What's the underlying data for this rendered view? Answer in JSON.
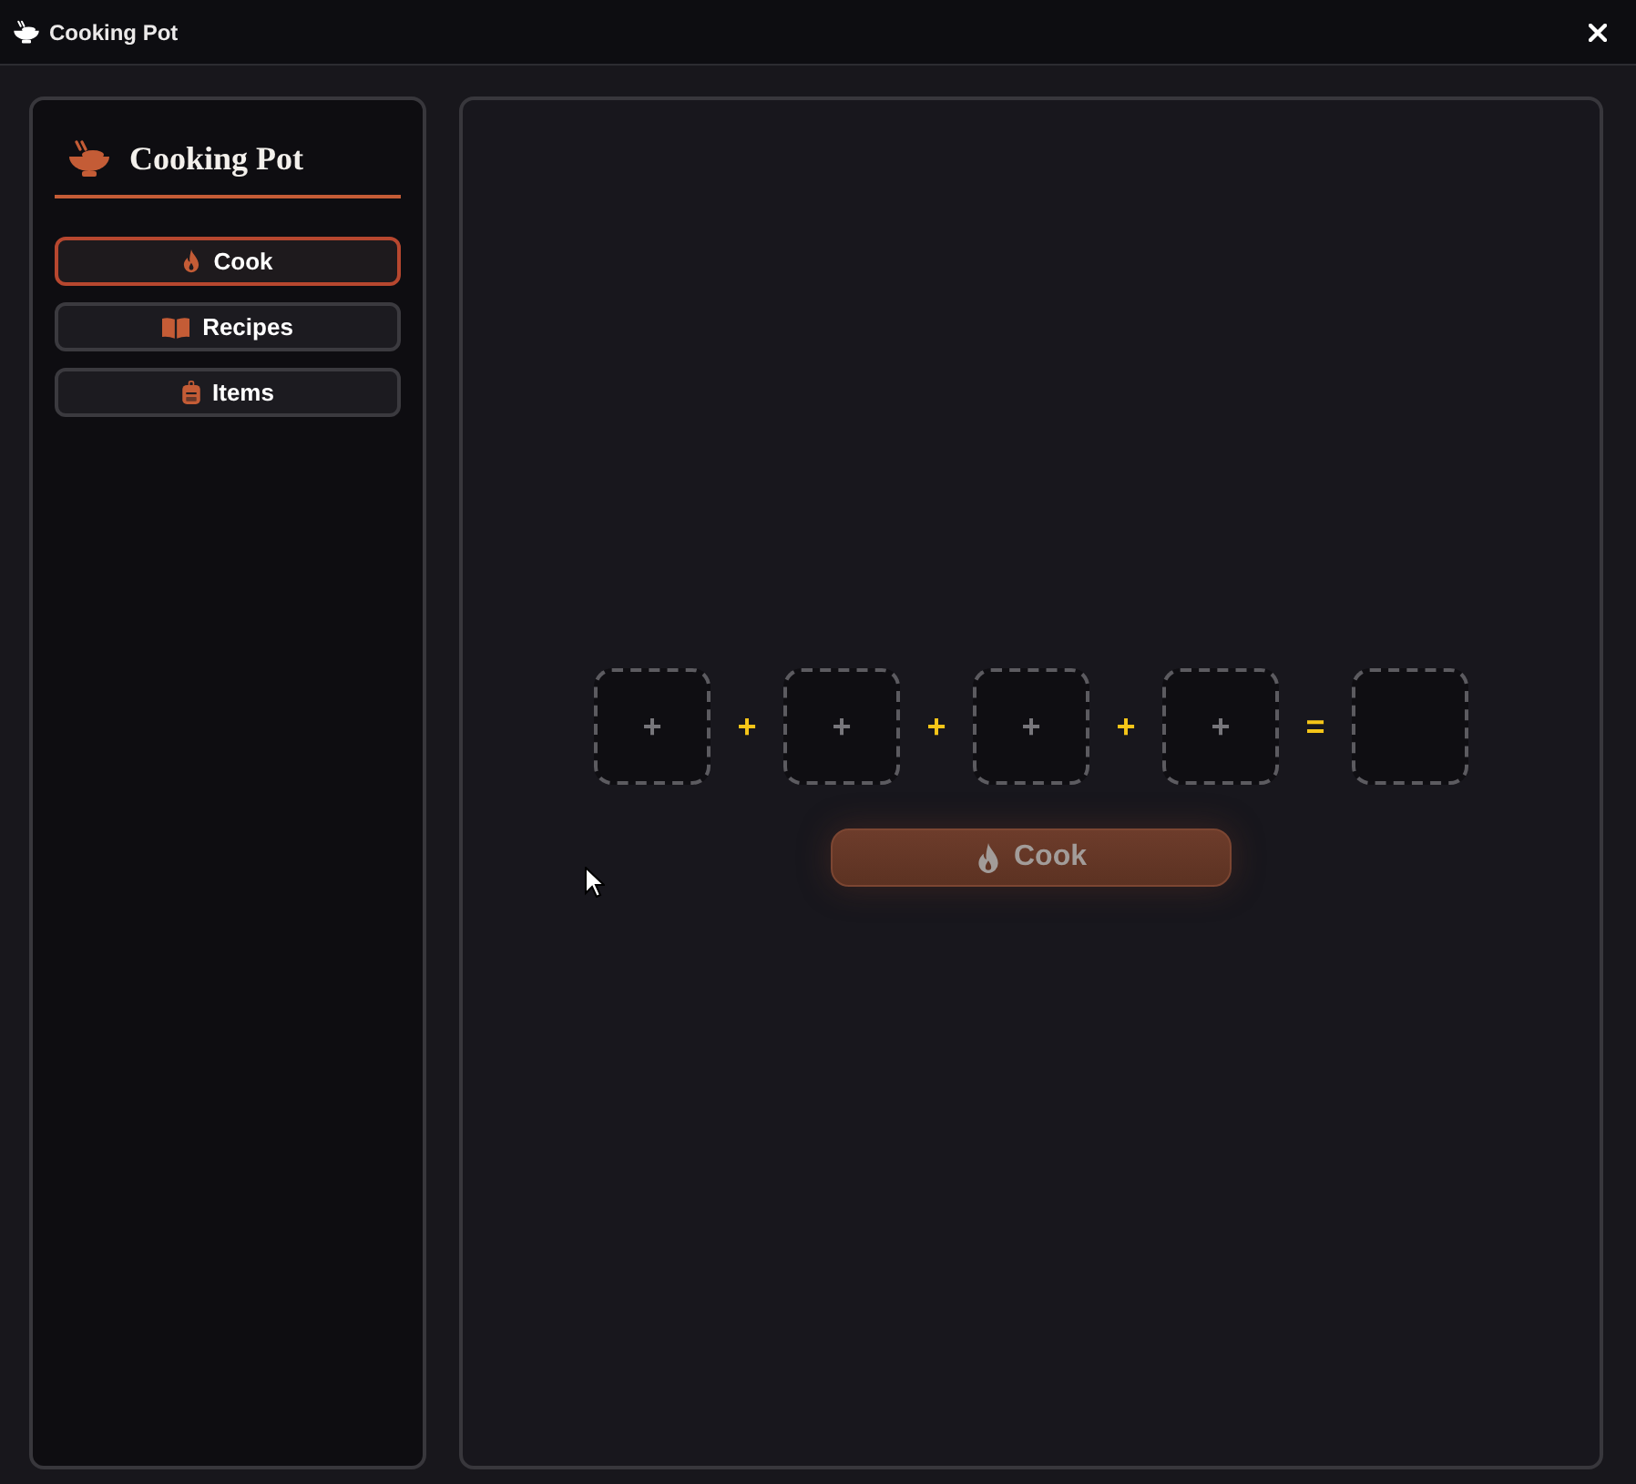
{
  "window": {
    "title": "Cooking Pot"
  },
  "sidebar": {
    "title": "Cooking Pot",
    "items": [
      {
        "label": "Cook",
        "kind": "cook",
        "selected": true
      },
      {
        "label": "Recipes",
        "kind": "recipes",
        "selected": false
      },
      {
        "label": "Items",
        "kind": "items",
        "selected": false
      }
    ]
  },
  "recipe_row": [
    {
      "kind": "slot",
      "text": "+"
    },
    {
      "kind": "operator",
      "text": "+"
    },
    {
      "kind": "slot",
      "text": "+"
    },
    {
      "kind": "operator",
      "text": "+"
    },
    {
      "kind": "slot",
      "text": "+"
    },
    {
      "kind": "operator",
      "text": "+"
    },
    {
      "kind": "slot",
      "text": "+"
    },
    {
      "kind": "operator",
      "text": "="
    },
    {
      "kind": "result"
    }
  ],
  "cook_button": {
    "label": "Cook",
    "disabled": true
  }
}
